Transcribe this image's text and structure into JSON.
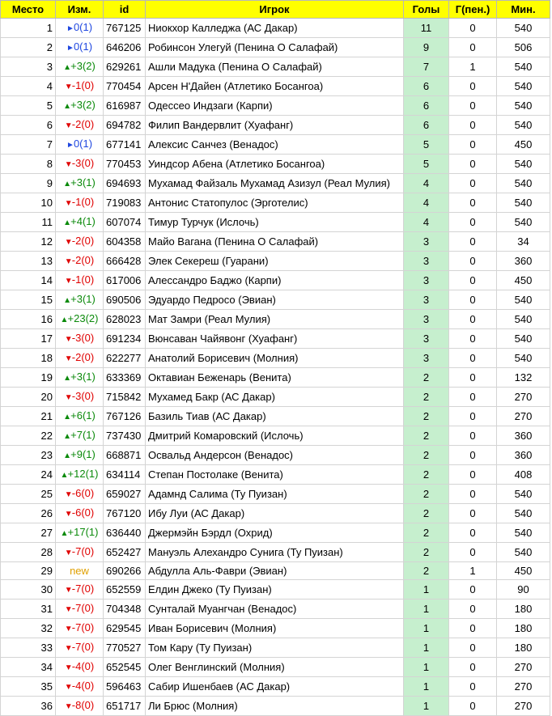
{
  "headers": {
    "place": "Место",
    "change": "Изм.",
    "id": "id",
    "player": "Игрок",
    "goals": "Голы",
    "pen": "Г(пен.)",
    "mins": "Мин."
  },
  "colors": {
    "header_bg": "#ffff00",
    "goals_bg": "#c6efce",
    "up": "#0b8a0b",
    "down": "#e00000",
    "same": "#2048e0",
    "new": "#e0a000"
  },
  "icons": {
    "up": "up-arrow-icon",
    "down": "down-arrow-icon",
    "same": "flag-marker-icon"
  },
  "rows": [
    {
      "place": "1",
      "dir": "same",
      "change": "0(1)",
      "id": "767125",
      "player": "Ниокхор Калледжа (АС Дакар)",
      "goals": "11",
      "pen": "0",
      "mins": "540"
    },
    {
      "place": "2",
      "dir": "same",
      "change": "0(1)",
      "id": "646206",
      "player": "Робинсон Улегуй (Пенина О Салафай)",
      "goals": "9",
      "pen": "0",
      "mins": "506"
    },
    {
      "place": "3",
      "dir": "up",
      "change": "+3(2)",
      "id": "629261",
      "player": "Ашли Мадука (Пенина О Салафай)",
      "goals": "7",
      "pen": "1",
      "mins": "540"
    },
    {
      "place": "4",
      "dir": "down",
      "change": "-1(0)",
      "id": "770454",
      "player": "Арсен Н'Дайен (Атлетико Босангоа)",
      "goals": "6",
      "pen": "0",
      "mins": "540"
    },
    {
      "place": "5",
      "dir": "up",
      "change": "+3(2)",
      "id": "616987",
      "player": "Одессео Индзаги (Карпи)",
      "goals": "6",
      "pen": "0",
      "mins": "540"
    },
    {
      "place": "6",
      "dir": "down",
      "change": "-2(0)",
      "id": "694782",
      "player": "Филип Вандервлит (Хуафанг)",
      "goals": "6",
      "pen": "0",
      "mins": "540"
    },
    {
      "place": "7",
      "dir": "same",
      "change": "0(1)",
      "id": "677141",
      "player": "Алексис Санчез (Венадос)",
      "goals": "5",
      "pen": "0",
      "mins": "450"
    },
    {
      "place": "8",
      "dir": "down",
      "change": "-3(0)",
      "id": "770453",
      "player": "Уиндсор Абена (Атлетико Босангоа)",
      "goals": "5",
      "pen": "0",
      "mins": "540"
    },
    {
      "place": "9",
      "dir": "up",
      "change": "+3(1)",
      "id": "694693",
      "player": "Мухамад Файзаль Мухамад Азизул (Реал Мулия)",
      "goals": "4",
      "pen": "0",
      "mins": "540"
    },
    {
      "place": "10",
      "dir": "down",
      "change": "-1(0)",
      "id": "719083",
      "player": "Антонис Статопулос (Эрготелис)",
      "goals": "4",
      "pen": "0",
      "mins": "540"
    },
    {
      "place": "11",
      "dir": "up",
      "change": "+4(1)",
      "id": "607074",
      "player": "Тимур Турчук (Ислочь)",
      "goals": "4",
      "pen": "0",
      "mins": "540"
    },
    {
      "place": "12",
      "dir": "down",
      "change": "-2(0)",
      "id": "604358",
      "player": "Майо Вагана (Пенина О Салафай)",
      "goals": "3",
      "pen": "0",
      "mins": "34"
    },
    {
      "place": "13",
      "dir": "down",
      "change": "-2(0)",
      "id": "666428",
      "player": "Элек Секереш (Гуарани)",
      "goals": "3",
      "pen": "0",
      "mins": "360"
    },
    {
      "place": "14",
      "dir": "down",
      "change": "-1(0)",
      "id": "617006",
      "player": "Алессандро Баджо (Карпи)",
      "goals": "3",
      "pen": "0",
      "mins": "450"
    },
    {
      "place": "15",
      "dir": "up",
      "change": "+3(1)",
      "id": "690506",
      "player": "Эдуардо Педросо (Эвиан)",
      "goals": "3",
      "pen": "0",
      "mins": "540"
    },
    {
      "place": "16",
      "dir": "up",
      "change": "+23(2)",
      "id": "628023",
      "player": "Мат Замри (Реал Мулия)",
      "goals": "3",
      "pen": "0",
      "mins": "540"
    },
    {
      "place": "17",
      "dir": "down",
      "change": "-3(0)",
      "id": "691234",
      "player": "Вюнсаван Чайявонг (Хуафанг)",
      "goals": "3",
      "pen": "0",
      "mins": "540"
    },
    {
      "place": "18",
      "dir": "down",
      "change": "-2(0)",
      "id": "622277",
      "player": "Анатолий Борисевич (Молния)",
      "goals": "3",
      "pen": "0",
      "mins": "540"
    },
    {
      "place": "19",
      "dir": "up",
      "change": "+3(1)",
      "id": "633369",
      "player": "Октавиан Беженарь (Венита)",
      "goals": "2",
      "pen": "0",
      "mins": "132"
    },
    {
      "place": "20",
      "dir": "down",
      "change": "-3(0)",
      "id": "715842",
      "player": "Мухамед Бакр (АС Дакар)",
      "goals": "2",
      "pen": "0",
      "mins": "270"
    },
    {
      "place": "21",
      "dir": "up",
      "change": "+6(1)",
      "id": "767126",
      "player": "Базиль Тиав (АС Дакар)",
      "goals": "2",
      "pen": "0",
      "mins": "270"
    },
    {
      "place": "22",
      "dir": "up",
      "change": "+7(1)",
      "id": "737430",
      "player": "Дмитрий Комаровский (Ислочь)",
      "goals": "2",
      "pen": "0",
      "mins": "360"
    },
    {
      "place": "23",
      "dir": "up",
      "change": "+9(1)",
      "id": "668871",
      "player": "Освальд Андерсон (Венадос)",
      "goals": "2",
      "pen": "0",
      "mins": "360"
    },
    {
      "place": "24",
      "dir": "up",
      "change": "+12(1)",
      "id": "634114",
      "player": "Степан Постолаке (Венита)",
      "goals": "2",
      "pen": "0",
      "mins": "408"
    },
    {
      "place": "25",
      "dir": "down",
      "change": "-6(0)",
      "id": "659027",
      "player": "Адамнд Салима (Ту Пуизан)",
      "goals": "2",
      "pen": "0",
      "mins": "540"
    },
    {
      "place": "26",
      "dir": "down",
      "change": "-6(0)",
      "id": "767120",
      "player": "Ибу Луи (АС Дакар)",
      "goals": "2",
      "pen": "0",
      "mins": "540"
    },
    {
      "place": "27",
      "dir": "up",
      "change": "+17(1)",
      "id": "636440",
      "player": "Джермэйн Бэрдл (Охрид)",
      "goals": "2",
      "pen": "0",
      "mins": "540"
    },
    {
      "place": "28",
      "dir": "down",
      "change": "-7(0)",
      "id": "652427",
      "player": "Мануэль Алехандро Сунига (Ту Пуизан)",
      "goals": "2",
      "pen": "0",
      "mins": "540"
    },
    {
      "place": "29",
      "dir": "new",
      "change": "new",
      "id": "690266",
      "player": "Абдулла Аль-Фаври (Эвиан)",
      "goals": "2",
      "pen": "1",
      "mins": "450"
    },
    {
      "place": "30",
      "dir": "down",
      "change": "-7(0)",
      "id": "652559",
      "player": "Елдин Джеко (Ту Пуизан)",
      "goals": "1",
      "pen": "0",
      "mins": "90"
    },
    {
      "place": "31",
      "dir": "down",
      "change": "-7(0)",
      "id": "704348",
      "player": "Сунталай Муангчан (Венадос)",
      "goals": "1",
      "pen": "0",
      "mins": "180"
    },
    {
      "place": "32",
      "dir": "down",
      "change": "-7(0)",
      "id": "629545",
      "player": "Иван Борисевич (Молния)",
      "goals": "1",
      "pen": "0",
      "mins": "180"
    },
    {
      "place": "33",
      "dir": "down",
      "change": "-7(0)",
      "id": "770527",
      "player": "Том Кару (Ту Пуизан)",
      "goals": "1",
      "pen": "0",
      "mins": "180"
    },
    {
      "place": "34",
      "dir": "down",
      "change": "-4(0)",
      "id": "652545",
      "player": "Олег Венглинский (Молния)",
      "goals": "1",
      "pen": "0",
      "mins": "270"
    },
    {
      "place": "35",
      "dir": "down",
      "change": "-4(0)",
      "id": "596463",
      "player": "Сабир Ишенбаев (АС Дакар)",
      "goals": "1",
      "pen": "0",
      "mins": "270"
    },
    {
      "place": "36",
      "dir": "down",
      "change": "-8(0)",
      "id": "651717",
      "player": "Ли Брюс (Молния)",
      "goals": "1",
      "pen": "0",
      "mins": "270"
    }
  ]
}
